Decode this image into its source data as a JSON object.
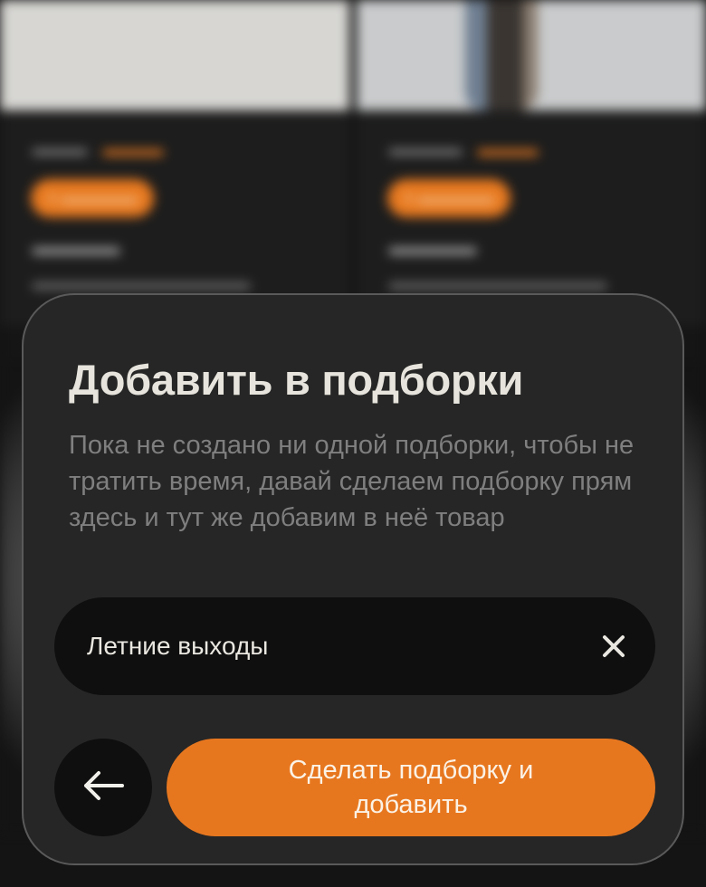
{
  "modal": {
    "title": "Добавить в подборки",
    "description": "Пока не создано ни одной подборки, чтобы не тратить время, давай сделаем подборку прям здесь и тут же добавим в неё товар",
    "input_value": "Летние выходы",
    "clear_icon": "close-icon",
    "back_icon": "arrow-left-icon",
    "primary_button_label": "Сделать подборку и добавить"
  },
  "colors": {
    "accent": "#e7771f",
    "sheet_background": "#262626",
    "field_background": "#0f0f0f",
    "title_text": "#e6e4dc",
    "muted_text": "#7f7f7f"
  }
}
